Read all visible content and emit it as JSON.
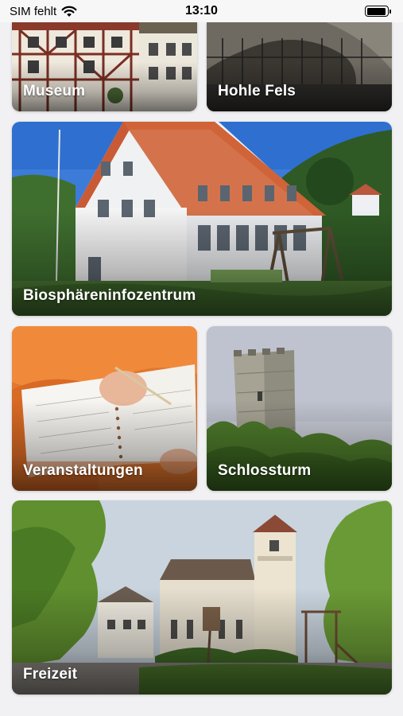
{
  "status_bar": {
    "carrier": "SIM fehlt",
    "time": "13:10",
    "battery_level": 0.95
  },
  "tiles": {
    "museum": {
      "label": "Museum"
    },
    "hohle_fels": {
      "label": "Hohle Fels"
    },
    "biosphaere": {
      "label": "Biosphäreninfozentrum"
    },
    "veranstaltungen": {
      "label": "Veranstaltungen"
    },
    "schlossturm": {
      "label": "Schlossturm"
    },
    "freizeit": {
      "label": "Freizeit"
    }
  },
  "colors": {
    "background": "#f1f1f3",
    "tile_text": "#ffffff"
  }
}
